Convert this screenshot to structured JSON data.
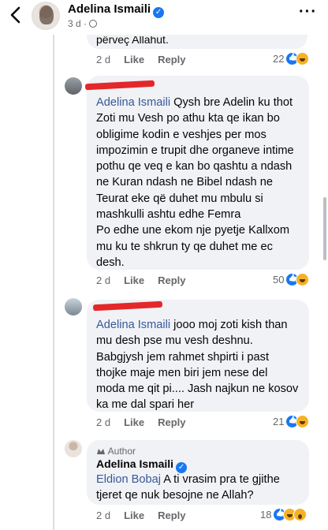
{
  "header": {
    "name": "Adelina Ismaili",
    "meta": "3 d ·",
    "icons": {
      "back": "chevron-left-icon",
      "more": "more-dots-icon",
      "privacy": "globe-icon"
    }
  },
  "top_comment": {
    "text_partial": "përveç Allahut.",
    "time": "2 d",
    "like": "Like",
    "reply": "Reply",
    "count": "22"
  },
  "reply1": {
    "mention": "Adelina Ismaili",
    "lines": [
      " Qysh bre Adelin ku thot",
      "Zoti mu Vesh po athu kta qe ikan bo",
      "obligime kodin e veshjes per mos",
      "impozimin e trupit dhe organeve intime",
      "pothu qe veq e kan bo qashtu a ndash",
      "ne Kuran ndash ne Bibel ndash ne",
      "Teurat eke që duhet mu mbulu si",
      "mashkulli ashtu edhe Femra",
      "Po edhe une ekom nje pyetje Kallxom",
      "mu ku te shkrun ty qe duhet me ec",
      "desh."
    ],
    "time": "2 d",
    "like": "Like",
    "reply": "Reply",
    "count": "50"
  },
  "reply2": {
    "mention": "Adelina Ismaili",
    "lines": [
      " jooo moj zoti kish than",
      "mu desh pse mu vesh deshnu.",
      "Babgjysh jem rahmet shpirti i past",
      "thojke maje men biri jem nese del",
      "moda me qit pi.... Jash najkun ne kosov",
      "ka me dal spari her"
    ],
    "time": "2 d",
    "like": "Like",
    "reply": "Reply",
    "count": "21"
  },
  "reply3": {
    "author_tag": "Author",
    "name": "Adelina Ismaili",
    "mention": "Eldion Bobaj",
    "lines": [
      " A ti vrasim pra te gjithe",
      "tjeret qe nuk besojne ne Allah?"
    ],
    "time": "2 d",
    "like": "Like",
    "reply": "Reply",
    "count": "18"
  },
  "colors": {
    "accent": "#1877f2",
    "mention": "#385898",
    "bubble": "#f0f2f5",
    "redaction": "#e4272a"
  }
}
